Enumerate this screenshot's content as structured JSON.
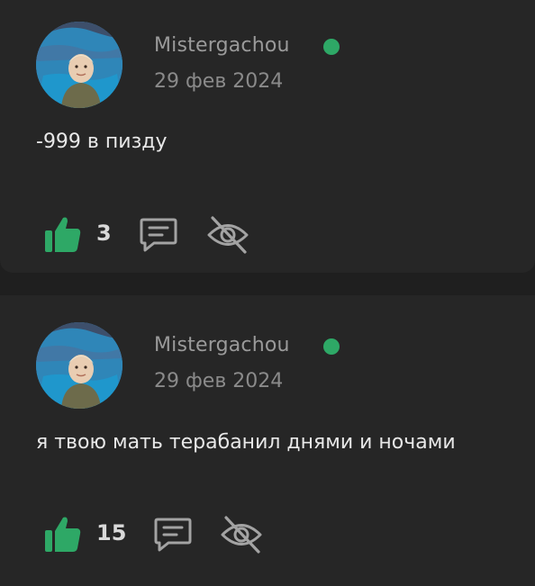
{
  "comments": [
    {
      "username": "Mistergachou",
      "date": "29 фев 2024",
      "text": "-999 в пизду",
      "likes": "3",
      "online": true
    },
    {
      "username": "Mistergachou",
      "date": "29 фев 2024",
      "text": "я твою мать терабанил днями и ночами",
      "likes": "15",
      "online": true
    }
  ],
  "colors": {
    "background": "#1f1f1f",
    "card": "#262626",
    "online": "#2ea866",
    "like": "#2ea866",
    "icon": "#a3a3a3"
  },
  "icons": [
    "avatar",
    "online-dot",
    "thumbs-up-icon",
    "comment-icon",
    "hidden-eye-icon"
  ]
}
